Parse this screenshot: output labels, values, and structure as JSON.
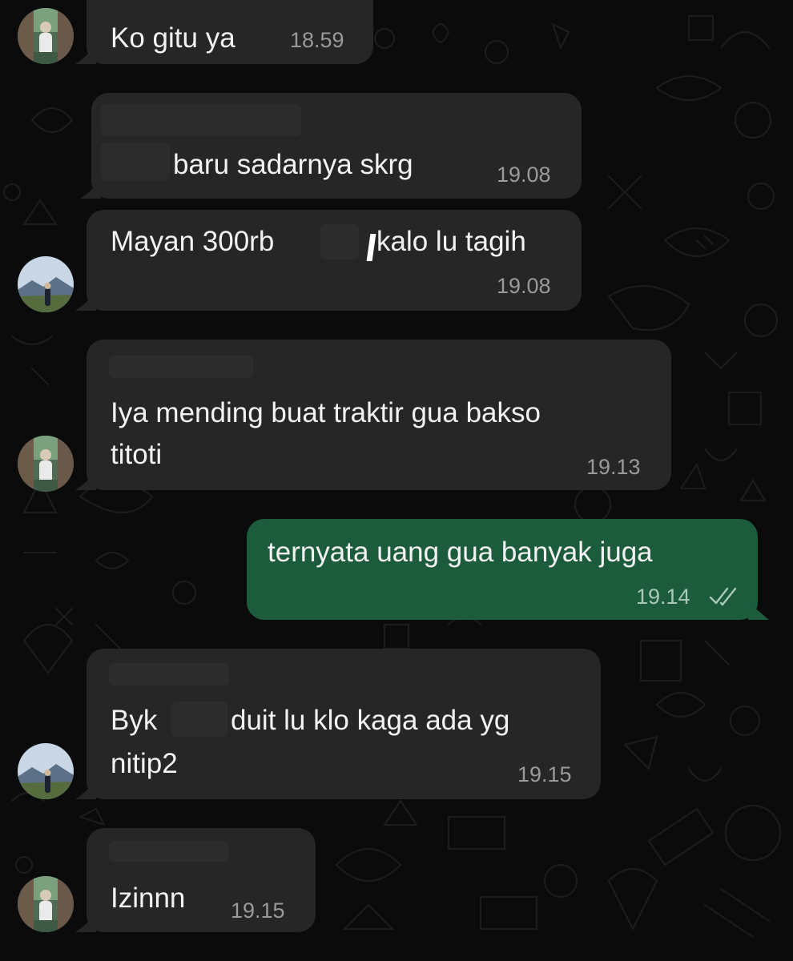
{
  "messages": [
    {
      "id": "m1",
      "direction": "incoming",
      "text": "Ko gitu ya",
      "time": "18.59"
    },
    {
      "id": "m2",
      "direction": "incoming",
      "text": "baru sadarnya skrg",
      "time": "19.08"
    },
    {
      "id": "m3",
      "direction": "incoming",
      "text_part1": "Mayan 300rb",
      "text_part2": "kalo lu tagih",
      "time": "19.08"
    },
    {
      "id": "m4",
      "direction": "incoming",
      "line1": "Iya mending buat traktir gua bakso",
      "line2": "titoti",
      "time": "19.13"
    },
    {
      "id": "m5",
      "direction": "outgoing",
      "text": "ternyata uang gua banyak juga",
      "time": "19.14",
      "status": "read-double-check-icon"
    },
    {
      "id": "m6",
      "direction": "incoming",
      "line1_part1": "Byk",
      "line1_part2": "duit lu klo kaga ada yg",
      "line2": "nitip2",
      "time": "19.15"
    },
    {
      "id": "m7",
      "direction": "incoming",
      "text": "Izinnn",
      "time": "19.15"
    }
  ],
  "colors": {
    "background": "#0b0b0b",
    "incoming_bubble": "#262626",
    "outgoing_bubble": "#1c5b3c",
    "text": "#f2f2f2",
    "timestamp": "#9a9a9a"
  },
  "icons": {
    "avatar_a": "avatar-garden-photo",
    "avatar_b": "avatar-mountain-photo",
    "read_status": "double-check-icon"
  }
}
